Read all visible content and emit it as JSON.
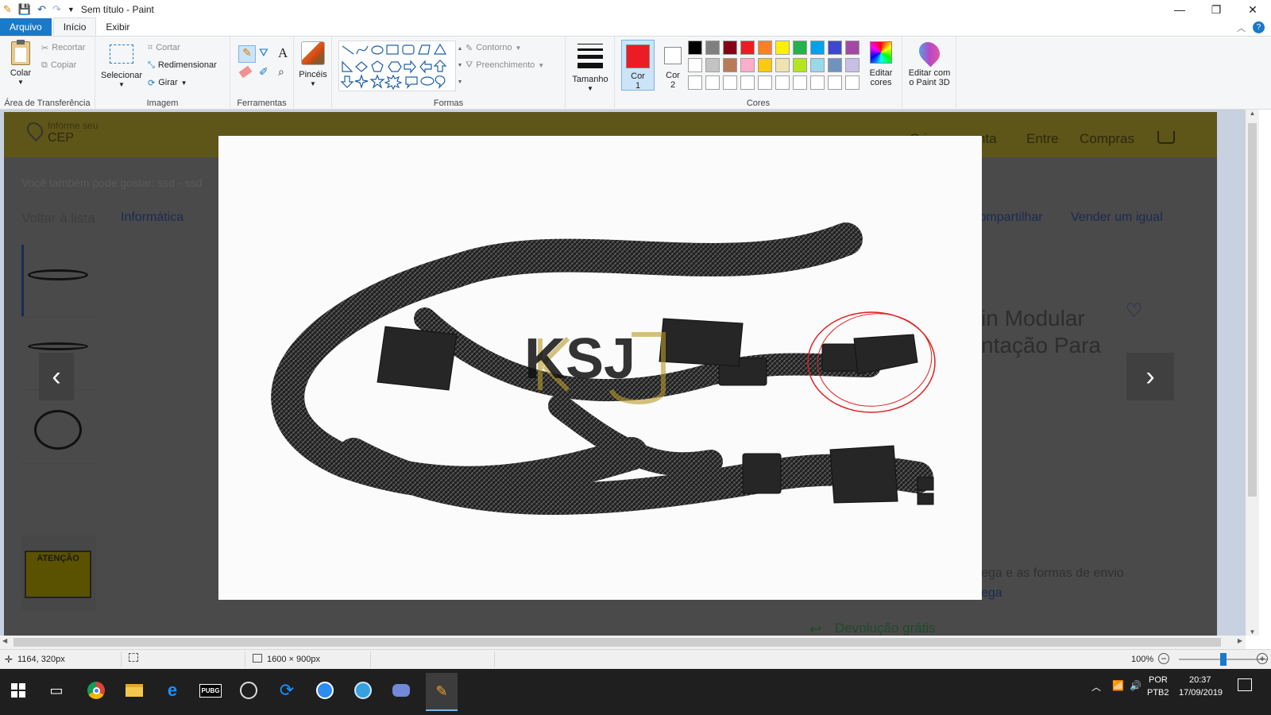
{
  "window": {
    "title": "Sem título - Paint",
    "minimize": "—",
    "restore": "❐",
    "close": "✕"
  },
  "tabs": {
    "file": "Arquivo",
    "home": "Início",
    "view": "Exibir"
  },
  "ribbon": {
    "clipboard": {
      "paste": "Colar",
      "cut": "Recortar",
      "copy": "Copiar",
      "name": "Área de Transferência"
    },
    "image": {
      "select": "Selecionar",
      "crop": "Cortar",
      "resize": "Redimensionar",
      "rotate": "Girar",
      "name": "Imagem"
    },
    "tools": {
      "name": "Ferramentas",
      "text_tool": "A"
    },
    "brushes": {
      "label": "Pincéis"
    },
    "shapes": {
      "outline": "Contorno",
      "fill": "Preenchimento",
      "name": "Formas"
    },
    "size": {
      "label": "Tamanho"
    },
    "colors": {
      "color1_line1": "Cor",
      "color1_line2": "1",
      "color2_line1": "Cor",
      "color2_line2": "2",
      "edit_line1": "Editar",
      "edit_line2": "cores",
      "name": "Cores",
      "color1_value": "#ed1c24",
      "color2_value": "#ffffff",
      "palette_row1": [
        "#000000",
        "#7f7f7f",
        "#880015",
        "#ed1c24",
        "#ff7f27",
        "#fff200",
        "#22b14c",
        "#00a2e8",
        "#3f48cc",
        "#a349a4"
      ],
      "palette_row2": [
        "#ffffff",
        "#c3c3c3",
        "#b97a57",
        "#ffaec9",
        "#ffc90e",
        "#efe4b0",
        "#b5e61d",
        "#99d9ea",
        "#7092be",
        "#c8bfe7"
      ]
    },
    "paint3d": {
      "line1": "Editar com",
      "line2": "o Paint 3D"
    }
  },
  "webpage": {
    "cep_small": "Informe seu",
    "cep": "CEP",
    "create_account": "Crie sua conta",
    "login": "Entre",
    "purchases": "Compras",
    "suggest": "Você também pode gostar: ssd - ssd",
    "back": "Voltar à lista",
    "breadcrumb": "Informática",
    "share": "Compartilhar",
    "sell": "Vender um igual",
    "title_l1": "in Modular",
    "title_l2": "ntação Para",
    "shipping_l1": "ega e as formas de envio",
    "shipping_l2": "ega",
    "return": "Devolução grátis",
    "thumb_warning": "ATENÇÃO",
    "watermark": "KSJ"
  },
  "status": {
    "cursor": "1164, 320px",
    "size": "1600 × 900px",
    "zoom": "100%",
    "zoom_fraction": 0.5
  },
  "taskbar": {
    "lang1": "POR",
    "lang2": "PTB2",
    "time": "20:37",
    "date": "17/09/2019",
    "pubg": "PUBG"
  }
}
